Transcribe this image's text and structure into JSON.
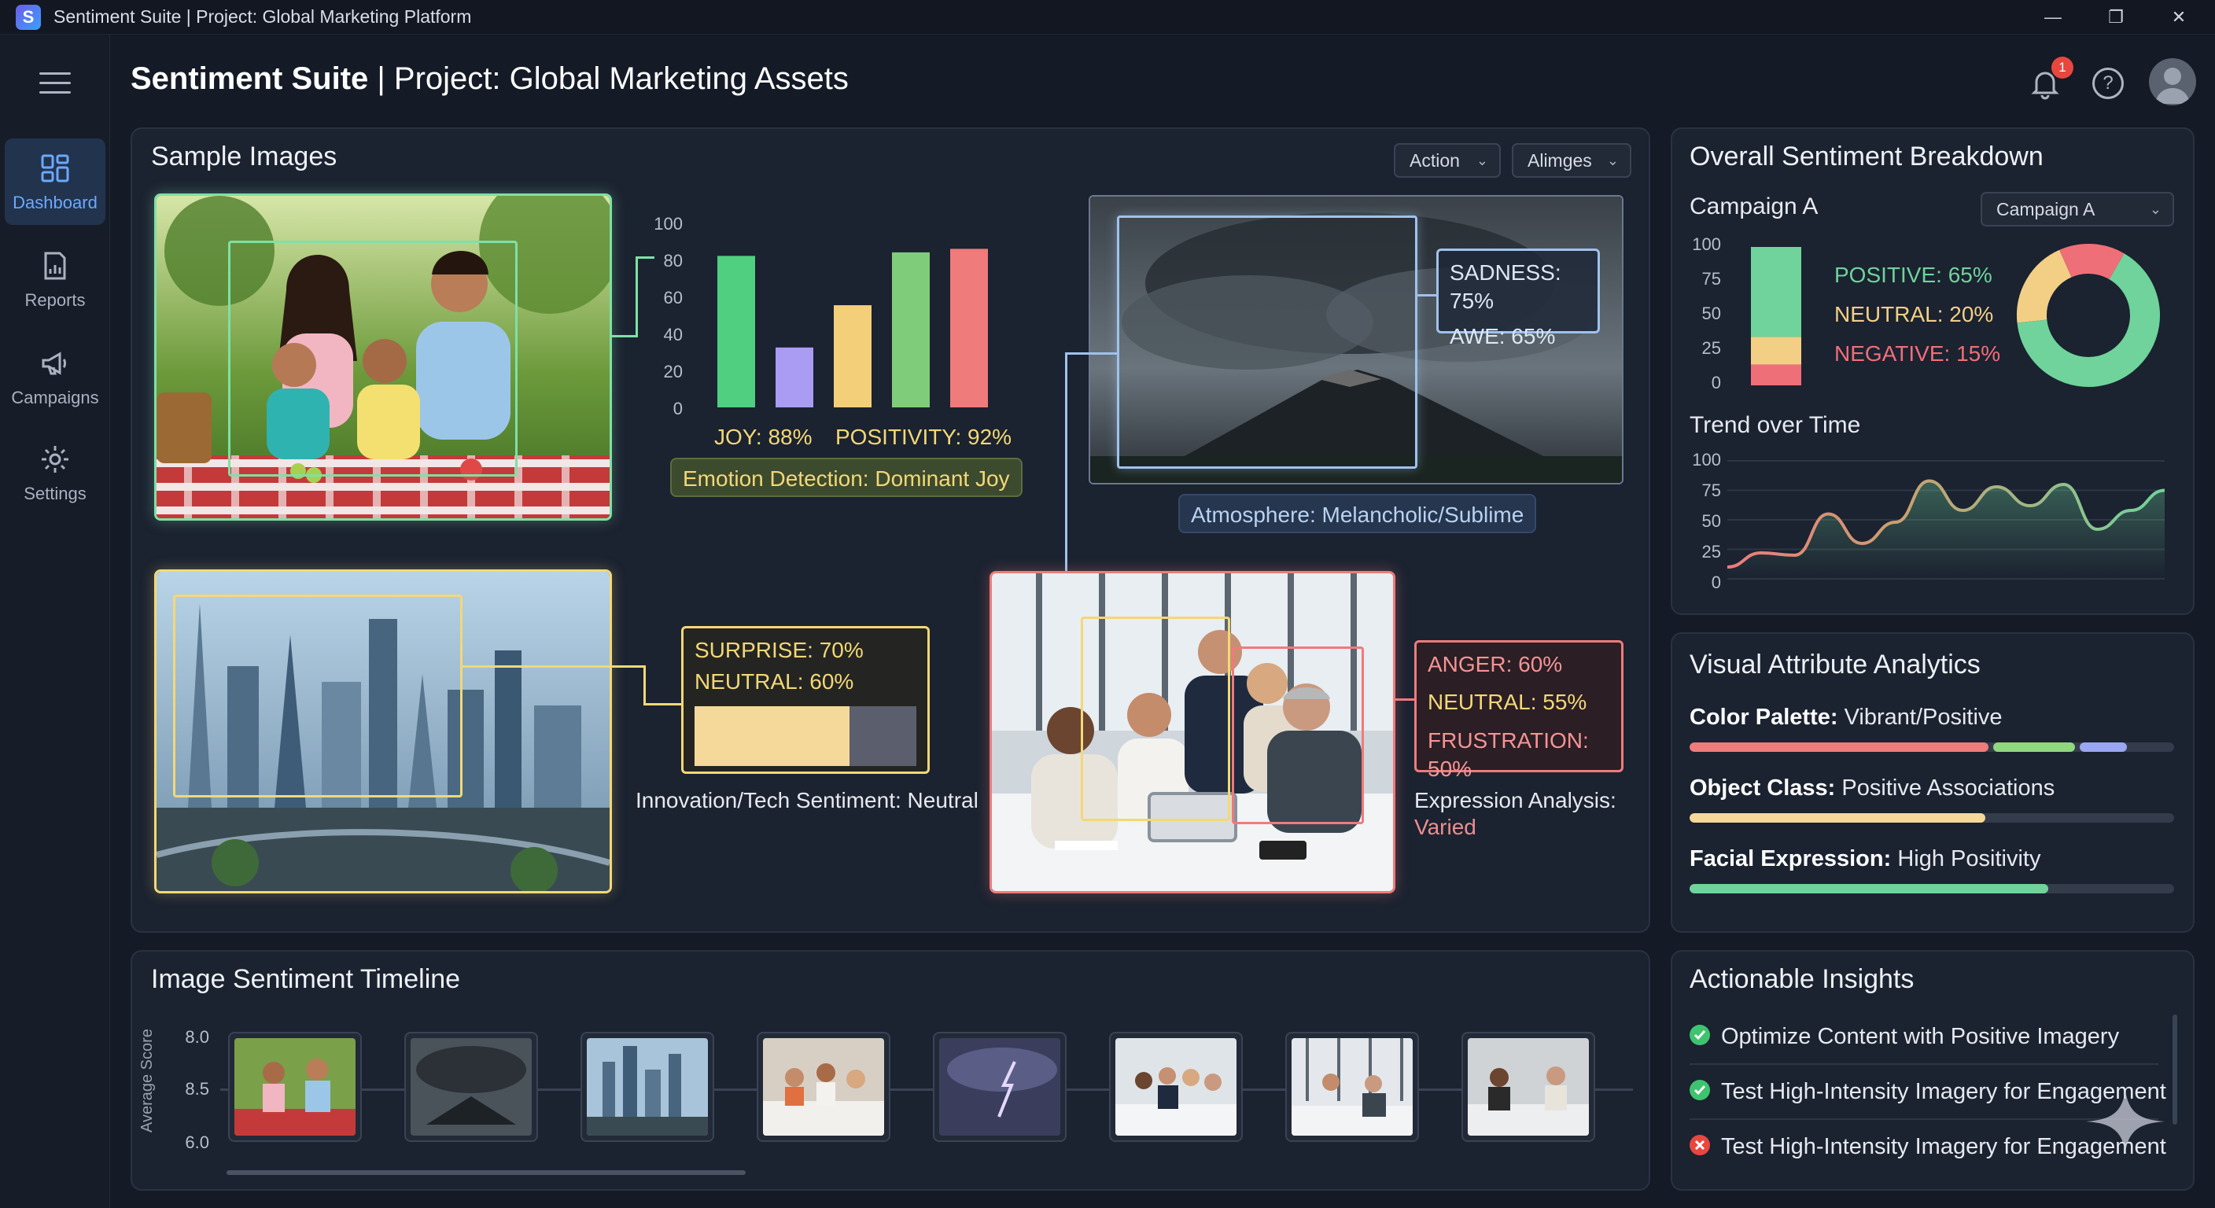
{
  "window": {
    "title": "Sentiment Suite | Project: Global Marketing Platform",
    "logo_letter": "S"
  },
  "header": {
    "app_name": "Sentiment Suite",
    "separator": " | ",
    "project": "Project: Global Marketing Assets",
    "notification_count": "1",
    "help_glyph": "?"
  },
  "sidebar": {
    "items": [
      {
        "label": "Dashboard",
        "icon": "dashboard-icon",
        "active": true
      },
      {
        "label": "Reports",
        "icon": "reports-icon"
      },
      {
        "label": "Campaigns",
        "icon": "megaphone-icon"
      },
      {
        "label": "Settings",
        "icon": "gear-icon"
      }
    ]
  },
  "sample_images": {
    "title": "Sample Images",
    "filter_action": "Action",
    "filter_images": "Alimges",
    "family": {
      "joy": "JOY: 88%",
      "positivity": "POSITIVITY: 92%",
      "caption": "Emotion Detection: Dominant Joy"
    },
    "storm": {
      "sadness": "SADNESS: 75%",
      "awe": "AWE: 65%",
      "caption": "Atmosphere: Melancholic/Sublime"
    },
    "city": {
      "surprise": "SURPRISE: 70%",
      "neutral": "NEUTRAL: 60%",
      "caption": "Innovation/Tech Sentiment: Neutral",
      "surprise_fraction": 0.7
    },
    "office": {
      "anger": "ANGER: 60%",
      "neutral": "NEUTRAL: 55%",
      "frustration": "FRUSTRATION: 50%",
      "caption_line1": "Expression Analysis:",
      "caption_line2": "Varied"
    }
  },
  "chart_data": [
    {
      "type": "bar",
      "ylim": [
        0,
        100
      ],
      "yticks": [
        "100",
        "80",
        "60",
        "40",
        "20",
        "0"
      ],
      "values": [
        86,
        34,
        58,
        88,
        90
      ],
      "colors": [
        "#4fcf7f",
        "#a99cf2",
        "#f3cf7a",
        "#7fcd7a",
        "#ef7b7b"
      ]
    },
    {
      "type": "bar",
      "stacked": true,
      "ylim": [
        0,
        100
      ],
      "yticks": [
        "100",
        "75",
        "50",
        "25",
        "0"
      ],
      "series": [
        {
          "name": "POSITIVE: 65%",
          "value": 65,
          "color": "#6fd39b"
        },
        {
          "name": "NEUTRAL: 20%",
          "value": 20,
          "color": "#f3cf86"
        },
        {
          "name": "NEGATIVE: 15%",
          "value": 15,
          "color": "#ef6f78"
        }
      ]
    },
    {
      "type": "pie",
      "slices": [
        65,
        20,
        15
      ],
      "colors": [
        "#6fd39b",
        "#f3cf86",
        "#ef6f78"
      ]
    },
    {
      "type": "area",
      "title": "Trend over Time",
      "ylim": [
        0,
        100
      ],
      "yticks": [
        "100",
        "75",
        "50",
        "25",
        "0"
      ],
      "values": [
        10,
        22,
        20,
        55,
        30,
        48,
        83,
        58,
        78,
        62,
        80,
        42,
        58,
        75
      ]
    }
  ],
  "breakdown": {
    "title": "Overall Sentiment Breakdown",
    "campaign_label": "Campaign A",
    "campaign_select": "Campaign A",
    "positive": "POSITIVE: 65%",
    "neutral": "NEUTRAL: 20%",
    "negative": "NEGATIVE: 15%",
    "trend_title": "Trend over Time"
  },
  "attributes": {
    "title": "Visual Attribute Analytics",
    "color_label": "Color Palette:",
    "color_value": " Vibrant/Positive",
    "object_label": "Object Class:",
    "object_value": " Positive Associations",
    "object_fraction": 0.61,
    "face_label": "Facial Expression:",
    "face_value": " High Positivity",
    "face_fraction": 0.74
  },
  "timeline": {
    "title": "Image Sentiment Timeline",
    "ylabel": "Average Score",
    "yticks": [
      "8.0",
      "8.5",
      "6.0"
    ]
  },
  "insights": {
    "title": "Actionable Insights",
    "items": [
      {
        "text": "Optimize Content with Positive Imagery",
        "status": "check"
      },
      {
        "text": "Test High-Intensity Imagery for Engagement",
        "status": "check"
      },
      {
        "text": "Test High-Intensity Imagery for Engagement",
        "status": "cross"
      }
    ]
  }
}
